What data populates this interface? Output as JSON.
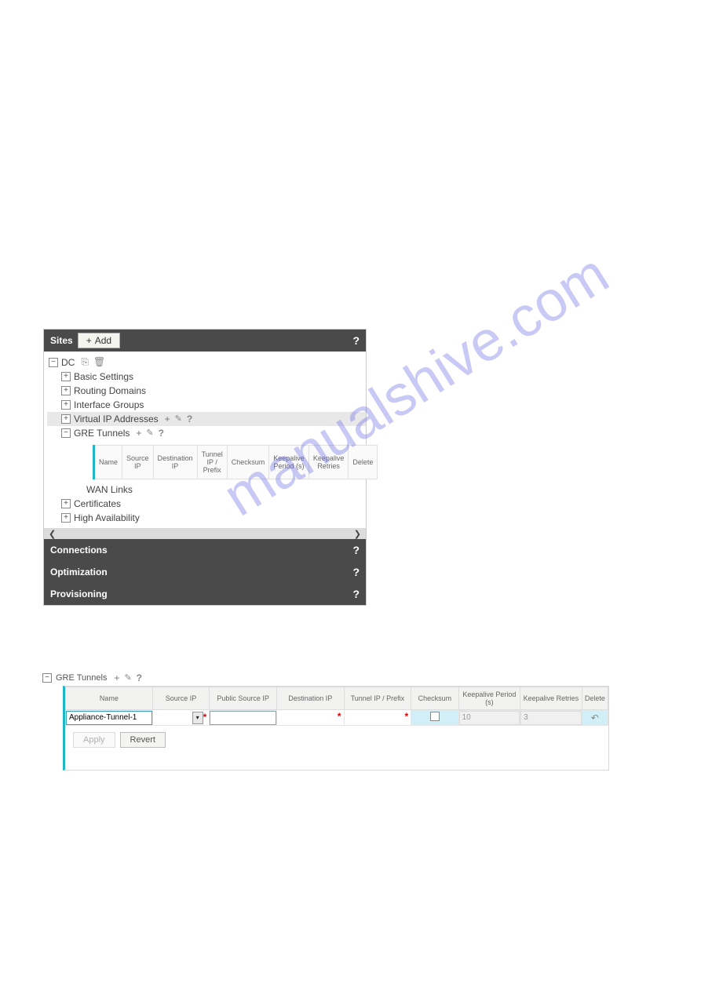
{
  "watermark": "manualshive.com",
  "panel_sites": {
    "title": "Sites",
    "add_label": "Add",
    "help": "?",
    "tree": {
      "root": {
        "label": "DC",
        "toggle": "−"
      },
      "basic_settings": {
        "label": "Basic Settings",
        "toggle": "+"
      },
      "routing_domains": {
        "label": "Routing Domains",
        "toggle": "+"
      },
      "interface_groups": {
        "label": "Interface Groups",
        "toggle": "+"
      },
      "virtual_ip": {
        "label": "Virtual IP Addresses",
        "toggle": "+"
      },
      "gre_tunnels": {
        "label": "GRE Tunnels",
        "toggle": "−"
      },
      "wan_links": {
        "label": "WAN Links"
      },
      "certificates": {
        "label": "Certificates",
        "toggle": "+"
      },
      "high_availability": {
        "label": "High Availability",
        "toggle": "+"
      }
    },
    "gre_table_headers": {
      "name": "Name",
      "source_ip": "Source IP",
      "destination_ip": "Destination IP",
      "tunnel_ip": "Tunnel IP / Prefix",
      "checksum": "Checksum",
      "keepalive_period": "Keepalive Period (s)",
      "keepalive_retries": "Keepalive Retries",
      "delete": "Delete"
    },
    "bars": {
      "connections": "Connections",
      "optimization": "Optimization",
      "provisioning": "Provisioning"
    },
    "scroll_left": "❮",
    "scroll_right": "❯"
  },
  "panel_gre_edit": {
    "title": "GRE Tunnels",
    "toggle": "−",
    "headers": {
      "name": "Name",
      "source_ip": "Source IP",
      "public_source_ip": "Public Source IP",
      "destination_ip": "Destination IP",
      "tunnel_ip": "Tunnel IP / Prefix",
      "checksum": "Checksum",
      "keepalive_period": "Keepalive Period (s)",
      "keepalive_retries": "Keepalive Retries",
      "delete": "Delete"
    },
    "row": {
      "name": "Appliance-Tunnel-1",
      "source_ip": "",
      "public_source_ip": "",
      "destination_ip": "",
      "tunnel_ip": "",
      "checksum": false,
      "keepalive_period": "10",
      "keepalive_retries": "3"
    },
    "apply_label": "Apply",
    "revert_label": "Revert"
  },
  "icons": {
    "plus": "+",
    "pencil": "✎",
    "help": "?",
    "copy": "⎘",
    "trash": "🗑",
    "undo": "↶"
  }
}
